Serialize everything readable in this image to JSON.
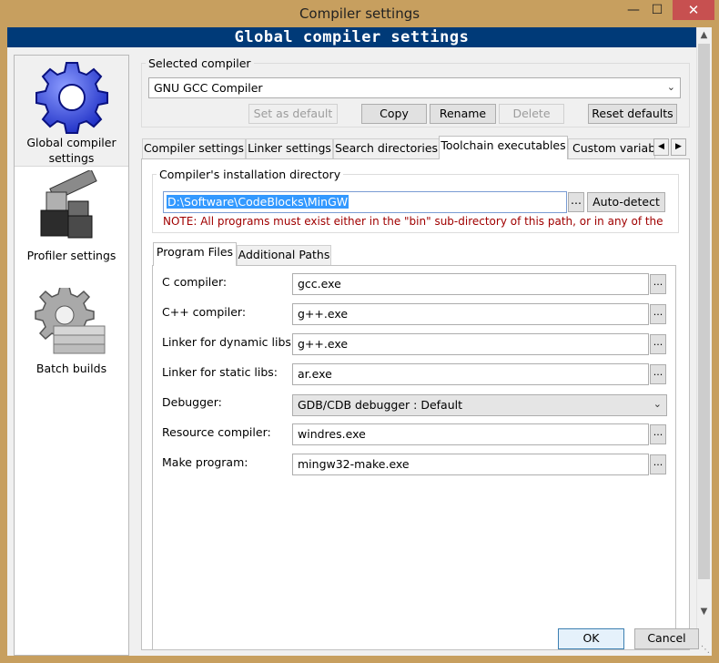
{
  "window": {
    "title": "Compiler settings",
    "minimize": "—",
    "maximize": "☐",
    "close": "✕"
  },
  "banner": "Global compiler settings",
  "sidebar": {
    "items": [
      {
        "label_line1": "Global compiler",
        "label_line2": "settings",
        "icon": "gear-icon",
        "selected": true
      },
      {
        "label": "Profiler settings",
        "icon": "profiler-icon"
      },
      {
        "label": "Batch builds",
        "icon": "batch-builds-icon"
      }
    ]
  },
  "selected_compiler": {
    "group_label": "Selected compiler",
    "value": "GNU GCC Compiler",
    "buttons": {
      "set_default": "Set as default",
      "copy": "Copy",
      "rename": "Rename",
      "delete": "Delete",
      "reset_defaults": "Reset defaults"
    }
  },
  "tabs": [
    {
      "label": "Compiler settings"
    },
    {
      "label": "Linker settings"
    },
    {
      "label": "Search directories"
    },
    {
      "label": "Toolchain executables",
      "active": true
    },
    {
      "label": "Custom variabl"
    }
  ],
  "install_dir": {
    "group_label": "Compiler's installation directory",
    "value": "D:\\Software\\CodeBlocks\\MinGW",
    "browse": "...",
    "auto_detect": "Auto-detect",
    "note": "NOTE: All programs must exist either in the \"bin\" sub-directory of this path, or in any of the"
  },
  "inner_tabs": [
    {
      "label": "Program Files",
      "active": true
    },
    {
      "label": "Additional Paths"
    }
  ],
  "programs": {
    "c_compiler": {
      "label": "C compiler:",
      "value": "gcc.exe"
    },
    "cpp_compiler": {
      "label": "C++ compiler:",
      "value": "g++.exe"
    },
    "linker_dynamic": {
      "label": "Linker for dynamic libs:",
      "value": "g++.exe"
    },
    "linker_static": {
      "label": "Linker for static libs:",
      "value": "ar.exe"
    },
    "debugger": {
      "label": "Debugger:",
      "value": "GDB/CDB debugger : Default"
    },
    "resource_compiler": {
      "label": "Resource compiler:",
      "value": "windres.exe"
    },
    "make_program": {
      "label": "Make program:",
      "value": "mingw32-make.exe"
    },
    "browse": "..."
  },
  "footer": {
    "ok": "OK",
    "cancel": "Cancel"
  },
  "colors": {
    "frame": "#c79f5f",
    "banner": "#003a78",
    "close": "#c75050",
    "note": "#a00000",
    "selection": "#3399ff"
  }
}
